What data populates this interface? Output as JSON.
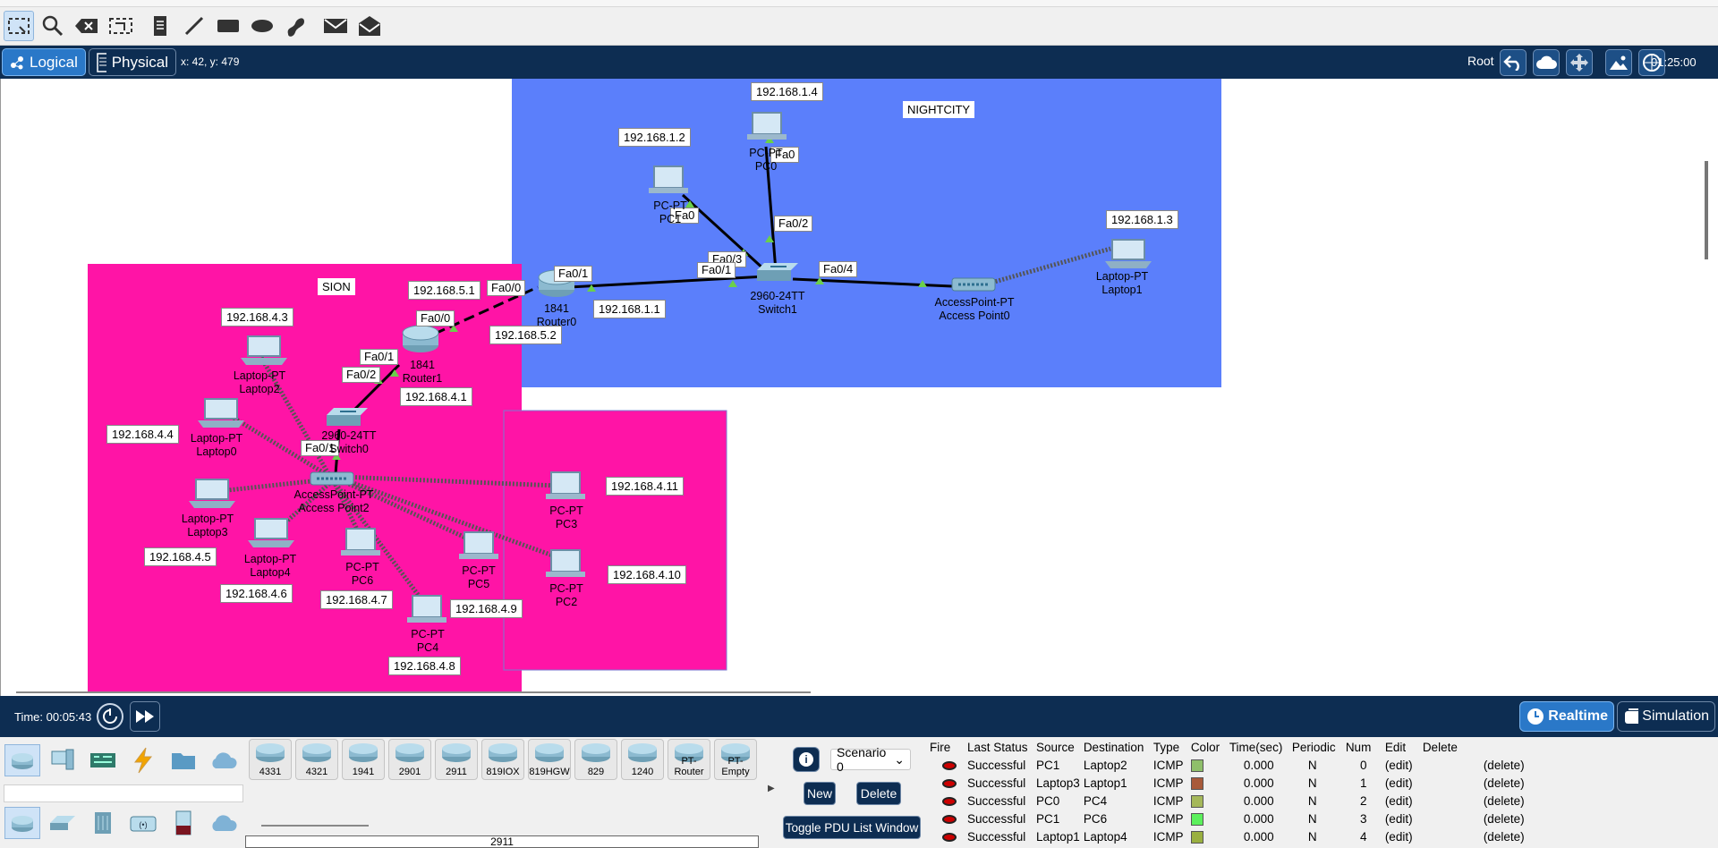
{
  "workspace": {
    "logical_tab": "Logical",
    "physical_tab": "Physical",
    "coords": "x: 42, y: 479",
    "root_label": "Root",
    "clock": "01:25:00"
  },
  "areas": {
    "nightcity": "NIGHTCITY",
    "sion": "SION"
  },
  "ip_labels": [
    "192.168.1.4",
    "192.168.1.2",
    "192.168.1.3",
    "192.168.1.1",
    "192.168.5.1",
    "192.168.5.2",
    "192.168.4.3",
    "192.168.4.1",
    "192.168.4.4",
    "192.168.4.11",
    "192.168.4.5",
    "192.168.4.10",
    "192.168.4.6",
    "192.168.4.7",
    "192.168.4.9",
    "192.168.4.8"
  ],
  "devices": {
    "pc0": [
      "PC-PT",
      "PC0"
    ],
    "pc1": [
      "PC-PT",
      "PC1"
    ],
    "switch1": [
      "2960-24TT",
      "Switch1"
    ],
    "router0": [
      "1841",
      "Router0"
    ],
    "ap0": [
      "AccessPoint-PT",
      "Access Point0"
    ],
    "laptop1": [
      "Laptop-PT",
      "Laptop1"
    ],
    "router1": [
      "1841",
      "Router1"
    ],
    "switch0": [
      "2960-24TT",
      "Switch0"
    ],
    "laptop2": [
      "Laptop-PT",
      "Laptop2"
    ],
    "laptop0": [
      "Laptop-PT",
      "Laptop0"
    ],
    "laptop3": [
      "Laptop-PT",
      "Laptop3"
    ],
    "laptop4": [
      "Laptop-PT",
      "Laptop4"
    ],
    "ap2": [
      "AccessPoint-PT",
      "Access Point2"
    ],
    "pc6": [
      "PC-PT",
      "PC6"
    ],
    "pc4": [
      "PC-PT",
      "PC4"
    ],
    "pc5": [
      "PC-PT",
      "PC5"
    ],
    "pc3": [
      "PC-PT",
      "PC3"
    ],
    "pc2": [
      "PC-PT",
      "PC2"
    ]
  },
  "ports": {
    "pc0_fa0": "Fa0",
    "pc1_fa0": "Fa0",
    "sw1_fa02": "Fa0/2",
    "sw1_fa03": "Fa0/3",
    "sw1_fa01": "Fa0/1",
    "sw1_fa04": "Fa0/4",
    "r0_fa01": "Fa0/1",
    "r0_fa00": "Fa0/0",
    "r1_fa00": "Fa0/0",
    "r1_fa01": "Fa0/1",
    "sw0_fa02": "Fa0/2",
    "sw0_fa01": "Fa0/1"
  },
  "bottom": {
    "time": "Time: 00:05:43",
    "realtime": "Realtime",
    "simulation": "Simulation",
    "models": [
      "4331",
      "4321",
      "1941",
      "2901",
      "2911",
      "819IOX",
      "819HGW",
      "829",
      "1240",
      "PT-Router",
      "PT-Empty"
    ],
    "selected_model": "2911",
    "scenario": "Scenario 0",
    "new_btn": "New",
    "delete_btn": "Delete",
    "toggle_btn": "Toggle PDU List Window",
    "info_btn": "i"
  },
  "pdu": {
    "headers": [
      "Fire",
      "Last Status",
      "Source",
      "Destination",
      "Type",
      "Color",
      "Time(sec)",
      "Periodic",
      "Num",
      "Edit",
      "Delete"
    ],
    "rows": [
      {
        "status": "Successful",
        "src": "PC1",
        "dst": "Laptop2",
        "type": "ICMP",
        "color": "#8fbf6a",
        "time": "0.000",
        "periodic": "N",
        "num": "0",
        "edit": "(edit)",
        "delete": "(delete)"
      },
      {
        "status": "Successful",
        "src": "Laptop3",
        "dst": "Laptop1",
        "type": "ICMP",
        "color": "#a85a3a",
        "time": "0.000",
        "periodic": "N",
        "num": "1",
        "edit": "(edit)",
        "delete": "(delete)"
      },
      {
        "status": "Successful",
        "src": "PC0",
        "dst": "PC4",
        "type": "ICMP",
        "color": "#a5b85a",
        "time": "0.000",
        "periodic": "N",
        "num": "2",
        "edit": "(edit)",
        "delete": "(delete)"
      },
      {
        "status": "Successful",
        "src": "PC1",
        "dst": "PC6",
        "type": "ICMP",
        "color": "#5cf05c",
        "time": "0.000",
        "periodic": "N",
        "num": "3",
        "edit": "(edit)",
        "delete": "(delete)"
      },
      {
        "status": "Successful",
        "src": "Laptop1",
        "dst": "Laptop4",
        "type": "ICMP",
        "color": "#9ab040",
        "time": "0.000",
        "periodic": "N",
        "num": "4",
        "edit": "(edit)",
        "delete": "(delete)"
      }
    ]
  },
  "colors": {
    "nightcity_bg": "#5b7ffb",
    "sion_bg": "#ff14a6",
    "toolbar_dark": "#0d2d52",
    "accent": "#2a78c8"
  },
  "icons": [
    "select-icon",
    "zoom-icon",
    "delete-icon",
    "resize-icon",
    "note-icon",
    "line-icon",
    "rectangle-icon",
    "ellipse-icon",
    "freeform-icon",
    "simple-pdu-icon",
    "complex-pdu-icon"
  ]
}
